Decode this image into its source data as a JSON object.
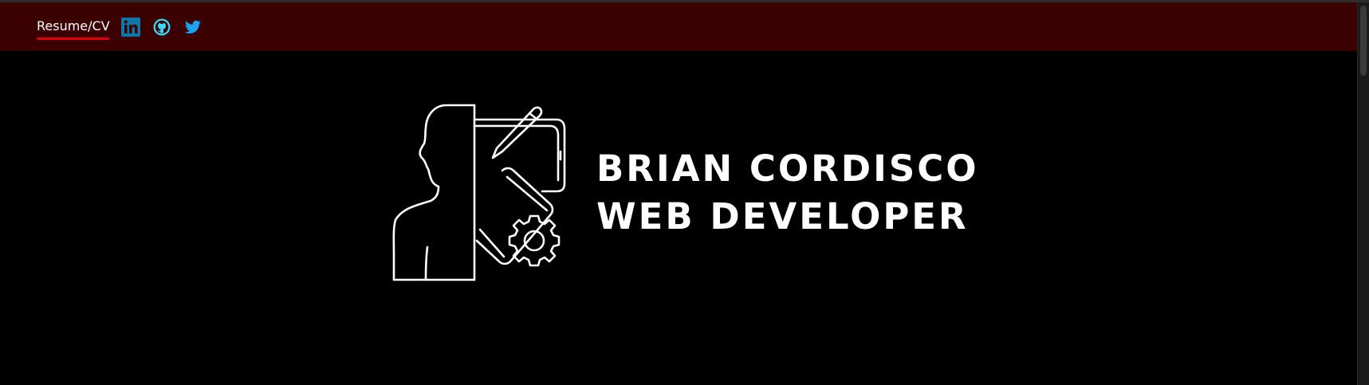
{
  "nav": {
    "resume_label": "Resume/CV",
    "accent_color": "#e00000",
    "background_color": "#3b0000",
    "social": [
      {
        "icon": "linkedin-icon",
        "color": "#0e76a8"
      },
      {
        "icon": "github-icon",
        "color": "#3dd6f5"
      },
      {
        "icon": "twitter-icon",
        "color": "#1da1f2"
      }
    ]
  },
  "hero": {
    "logo_icon": "developer-avatar-device-gear-icon",
    "name": "BRIAN CORDISCO",
    "role": "WEB DEVELOPER",
    "text_color": "#ffffff",
    "background_color": "#000000"
  }
}
